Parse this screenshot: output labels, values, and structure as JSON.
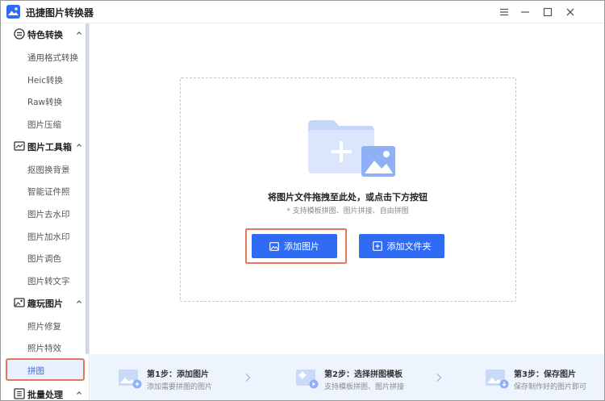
{
  "app": {
    "title": "迅捷图片转换器"
  },
  "sidebar": {
    "groups": [
      {
        "label": "特色转换",
        "items": [
          "通用格式转换",
          "Heic转换",
          "Raw转换",
          "图片压缩"
        ]
      },
      {
        "label": "图片工具箱",
        "items": [
          "抠图换背景",
          "智能证件照",
          "图片去水印",
          "图片加水印",
          "图片调色",
          "图片转文字"
        ]
      },
      {
        "label": "趣玩图片",
        "items": [
          "照片修复",
          "照片特效",
          "拼图"
        ]
      },
      {
        "label": "批量处理",
        "items": []
      }
    ],
    "active_item": "拼图"
  },
  "dropzone": {
    "title": "将图片文件拖拽至此处，或点击下方按钮",
    "subtitle": "* 支持模板拼图、图片拼接、自由拼图",
    "add_image_label": "添加图片",
    "add_folder_label": "添加文件夹"
  },
  "steps": [
    {
      "title": "第1步：添加图片",
      "desc": "添加需要拼图的图片"
    },
    {
      "title": "第2步：选择拼图模板",
      "desc": "支持模板拼图、图片拼接"
    },
    {
      "title": "第3步：保存图片",
      "desc": "保存制作好的图片即可"
    }
  ],
  "colors": {
    "accent": "#2f6bf3",
    "highlight": "#e07a5a",
    "active_bg": "#e9f0fe",
    "steps_bg": "#eef4fe"
  },
  "icons": {
    "group_icons": [
      "convert-icon",
      "toolbox-icon",
      "fun-image-icon",
      "batch-icon"
    ],
    "window": [
      "menu-icon",
      "minimize-icon",
      "maximize-icon",
      "close-icon"
    ]
  }
}
